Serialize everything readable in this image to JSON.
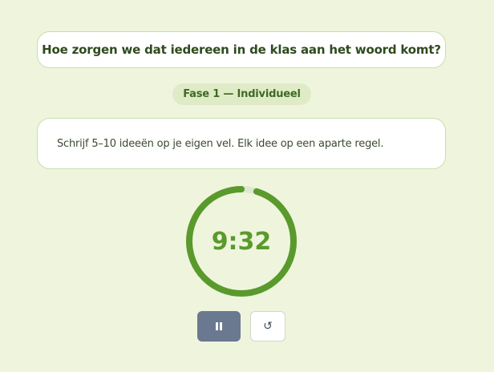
{
  "question": {
    "text": "Hoe zorgen we dat iedereen in de klas aan het woord komt?"
  },
  "phase": {
    "label": "Fase 1 — Individueel"
  },
  "instruction": {
    "text": "Schrijf 5–10 ideeën op je eigen vel. Elk idee op een aparte regel."
  },
  "timer": {
    "display": "9:32",
    "remaining_fraction": 0.953,
    "ring_color": "#5a9a2c",
    "track_color": "#dde8cc"
  },
  "controls": {
    "pause_icon": "pause-icon",
    "reset_glyph": "↺",
    "pause_color": "#6a7990"
  }
}
